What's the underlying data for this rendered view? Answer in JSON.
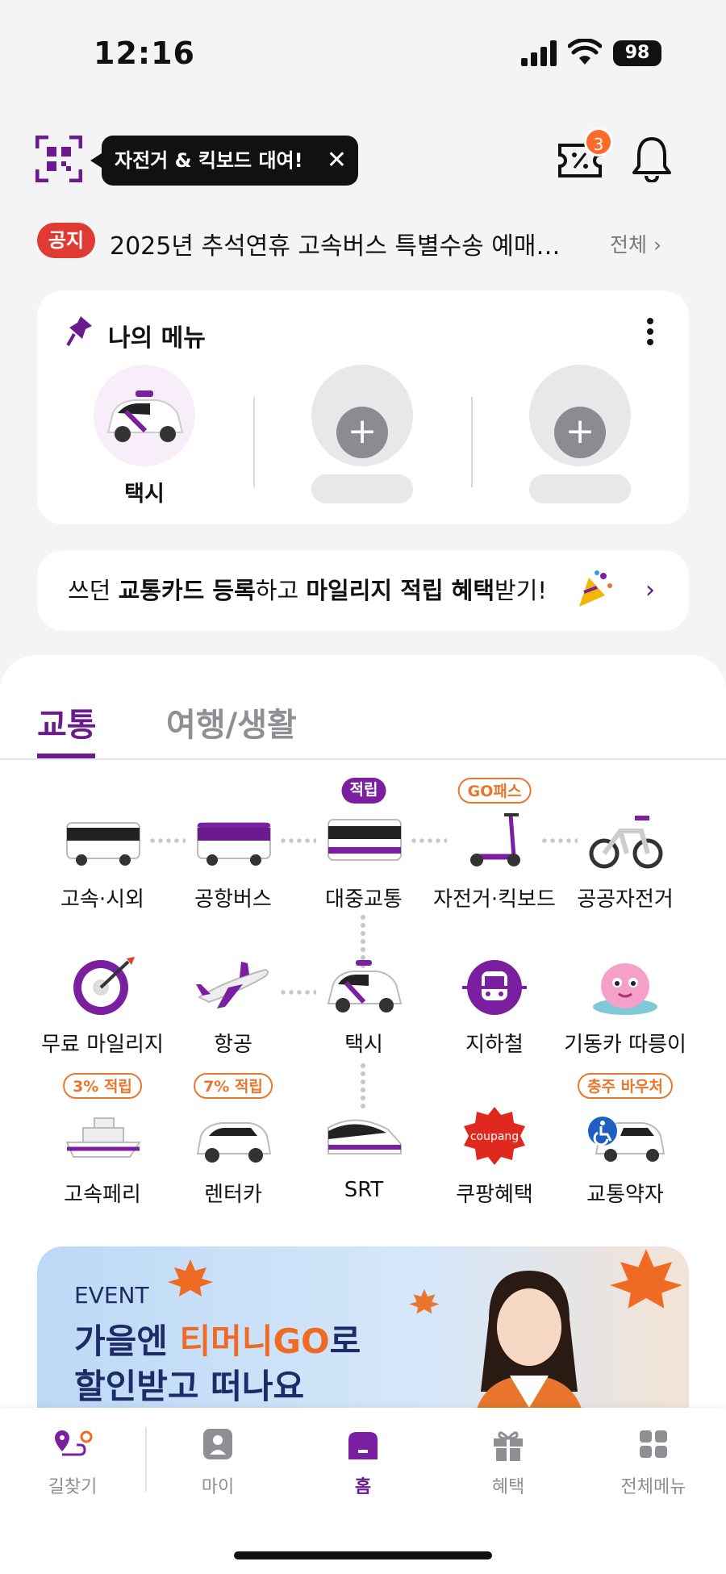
{
  "status_bar": {
    "time": "12:16",
    "battery": "98"
  },
  "header": {
    "tooltip": "자전거 & 킥보드 대여!",
    "tooltip_close": "✕",
    "coupon_count": "3"
  },
  "notice": {
    "tag": "공지",
    "text": "2025년 추석연휴 고속버스 특별수송 예매…",
    "all_label": "전체 ›"
  },
  "my_menu": {
    "title": "나의 메뉴",
    "slots": [
      {
        "label": "택시"
      },
      {
        "label": ""
      },
      {
        "label": ""
      }
    ]
  },
  "promo": {
    "part1": "쓰던 ",
    "bold1": "교통카드 등록",
    "part2": "하고 ",
    "bold2": "마일리지 적립 혜택",
    "part3": "받기!",
    "chevron": "›"
  },
  "tabs": [
    {
      "label": "교통",
      "active": true
    },
    {
      "label": "여행/생활",
      "active": false
    }
  ],
  "transport": {
    "row1": [
      {
        "label": "고속·시외",
        "icon": "express-bus-icon"
      },
      {
        "label": "공항버스",
        "icon": "airport-bus-icon"
      },
      {
        "label": "대중교통",
        "icon": "public-transit-icon",
        "badge": "적립"
      },
      {
        "label": "자전거·킥보드",
        "icon": "kickboard-icon",
        "badge": "GO패스"
      },
      {
        "label": "공공자전거",
        "icon": "public-bike-icon"
      }
    ],
    "row2": [
      {
        "label": "무료 마일리지",
        "icon": "mileage-target-icon"
      },
      {
        "label": "항공",
        "icon": "airplane-icon"
      },
      {
        "label": "택시",
        "icon": "taxi-icon"
      },
      {
        "label": "지하철",
        "icon": "subway-icon"
      },
      {
        "label": "기동카 따릉이",
        "icon": "mascot-icon"
      }
    ],
    "row3": [
      {
        "label": "고속페리",
        "icon": "ferry-icon",
        "badge": "3% 적립"
      },
      {
        "label": "렌터카",
        "icon": "rental-car-icon",
        "badge": "7% 적립"
      },
      {
        "label": "SRT",
        "icon": "srt-train-icon"
      },
      {
        "label": "쿠팡혜택",
        "icon": "coupang-icon",
        "brand_text": "coupang"
      },
      {
        "label": "교통약자",
        "icon": "accessible-taxi-icon",
        "badge": "충주 바우처"
      }
    ]
  },
  "event_banner": {
    "tag": "EVENT",
    "line1_a": "가을엔 ",
    "line1_hl": "티머니GO",
    "line1_b": "로",
    "line2": "할인받고 떠나요"
  },
  "bottom_nav": [
    {
      "label": "길찾기",
      "icon": "route-icon"
    },
    {
      "label": "마이",
      "icon": "profile-icon"
    },
    {
      "label": "홈",
      "icon": "home-icon",
      "active": true
    },
    {
      "label": "혜택",
      "icon": "gift-icon"
    },
    {
      "label": "전체메뉴",
      "icon": "grid-menu-icon"
    }
  ],
  "colors": {
    "brand": "#6a1b8e",
    "accent": "#ef6a22",
    "notice": "#e03a32"
  }
}
